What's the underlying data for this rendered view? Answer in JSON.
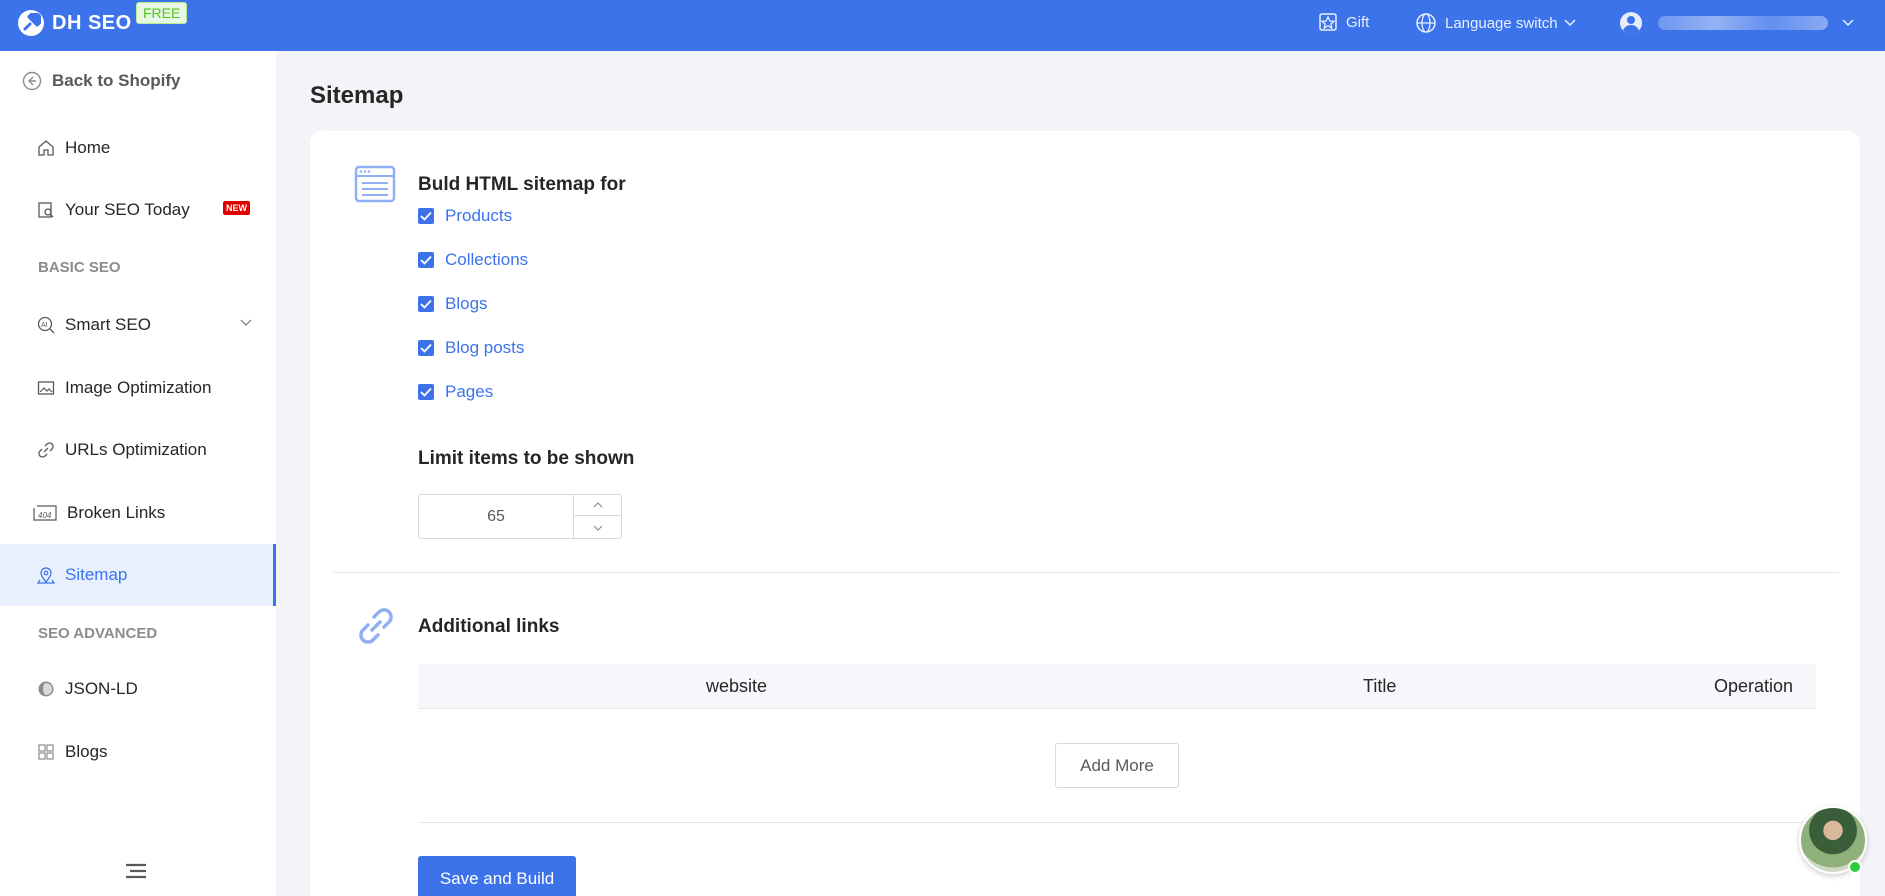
{
  "app": {
    "brand": "DH SEO",
    "plan_badge": "FREE"
  },
  "header": {
    "gift_label": "Gift",
    "language_label": "Language switch"
  },
  "sidebar": {
    "back_label": "Back to Shopify",
    "items": [
      {
        "label": "Home",
        "icon": "home-icon"
      },
      {
        "label": "Your SEO Today",
        "icon": "report-icon",
        "badge": "NEW"
      },
      {
        "label": "Smart SEO",
        "icon": "ai-icon"
      },
      {
        "label": "Image Optimization",
        "icon": "image-icon"
      },
      {
        "label": "URLs Optimization",
        "icon": "link-icon"
      },
      {
        "label": "Broken Links",
        "icon": "404-icon"
      },
      {
        "label": "Sitemap",
        "icon": "map-pin-icon",
        "active": true
      },
      {
        "label": "JSON-LD",
        "icon": "json-ld-icon"
      },
      {
        "label": "Blogs",
        "icon": "grid-icon"
      }
    ],
    "sections": [
      "BASIC SEO",
      "SEO ADVANCED"
    ]
  },
  "main": {
    "page_title": "Sitemap",
    "html_section": {
      "title": "Buld HTML sitemap for",
      "options": [
        {
          "label": "Products",
          "checked": true
        },
        {
          "label": "Collections",
          "checked": true
        },
        {
          "label": "Blogs",
          "checked": true
        },
        {
          "label": "Blog posts",
          "checked": true
        },
        {
          "label": "Pages",
          "checked": true
        }
      ]
    },
    "limit_section": {
      "title": "Limit items to be shown",
      "value": "65"
    },
    "links_section": {
      "title": "Additional links",
      "columns": [
        "website",
        "Title",
        "Operation"
      ],
      "add_more_label": "Add More"
    },
    "save_label": "Save and Build"
  },
  "colors": {
    "accent": "#3c73eb",
    "badge_red": "#e00000",
    "free_green": "#52c41a"
  }
}
